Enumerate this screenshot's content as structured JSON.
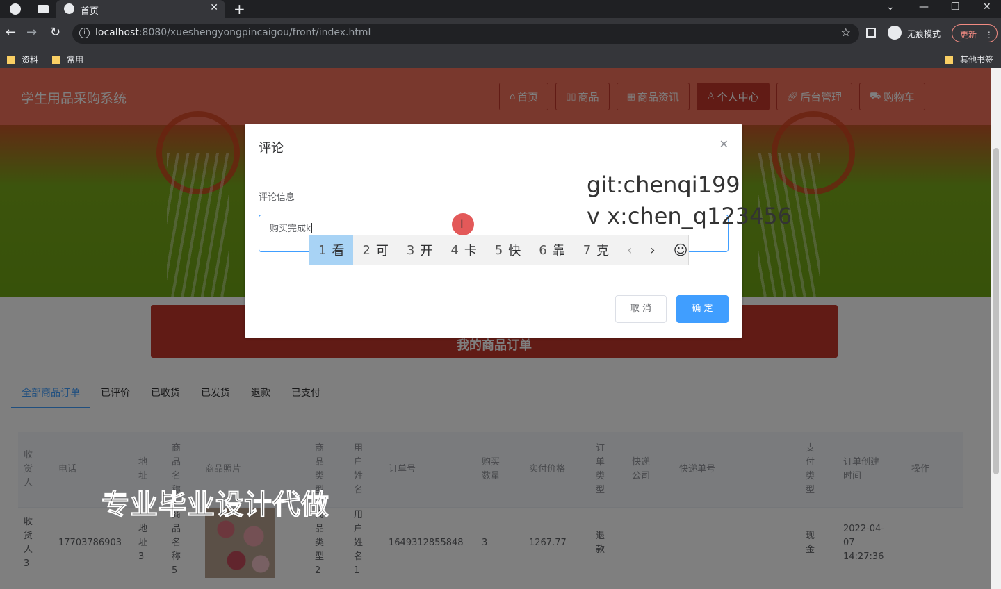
{
  "browser": {
    "tab_title": "首页",
    "url_host": "localhost",
    "url_rest": ":8080/xueshengyongpincaigou/front/index.html",
    "incognito_label": "无痕模式",
    "update_label": "更新",
    "bookmarks": [
      "资料",
      "常用"
    ],
    "other_bookmarks": "其他书签"
  },
  "site": {
    "title": "学生用品采购系统",
    "nav": [
      {
        "label": "首页",
        "icon": "home-icon"
      },
      {
        "label": "商品",
        "icon": "goods-icon"
      },
      {
        "label": "商品资讯",
        "icon": "news-icon"
      },
      {
        "label": "个人中心",
        "icon": "user-icon"
      },
      {
        "label": "后台管理",
        "icon": "link-icon"
      },
      {
        "label": "购物车",
        "icon": "cart-icon"
      }
    ],
    "active_nav": "个人中心",
    "accent": "#f3705a",
    "accent_dark": "#c2362a"
  },
  "orders": {
    "section_title": "我的商品订单",
    "tabs": [
      "全部商品订单",
      "已评价",
      "已收货",
      "已发货",
      "退款",
      "已支付"
    ],
    "active_tab": "全部商品订单",
    "columns": [
      "收货人",
      "电话",
      "地址",
      "商品名称",
      "商品照片",
      "商品类型",
      "用户姓名",
      "订单号",
      "购买数量",
      "实付价格",
      "订单类型",
      "快递公司",
      "快递单号",
      "支付类型",
      "订单创建时间",
      "操作"
    ],
    "rows": [
      {
        "receiver": "收货人3",
        "phone": "17703786903",
        "address": "地址3",
        "goods_name": "商品名称5",
        "goods_type": "商品类型2",
        "user_name": "用户姓名1",
        "order_no": "1649312855848",
        "quantity": "3",
        "price": "1267.77",
        "order_type": "退款",
        "courier": "",
        "tracking_no": "",
        "pay_type": "现金",
        "created": "2022-04-07 14:27:36",
        "actions": ""
      }
    ]
  },
  "dialog": {
    "title": "评论",
    "field_label": "评论信息",
    "textarea_value": "购买完成k",
    "cancel_label": "取 消",
    "confirm_label": "确 定"
  },
  "ime": {
    "candidates": [
      {
        "num": "1",
        "char": "看"
      },
      {
        "num": "2",
        "char": "可"
      },
      {
        "num": "3",
        "char": "开"
      },
      {
        "num": "4",
        "char": "卡"
      },
      {
        "num": "5",
        "char": "快"
      },
      {
        "num": "6",
        "char": "靠"
      },
      {
        "num": "7",
        "char": "克"
      }
    ]
  },
  "watermarks": {
    "line1": "git:chenqi199",
    "line2": "v x:chen_q123456",
    "banner_text": "专业毕业设计代做"
  }
}
